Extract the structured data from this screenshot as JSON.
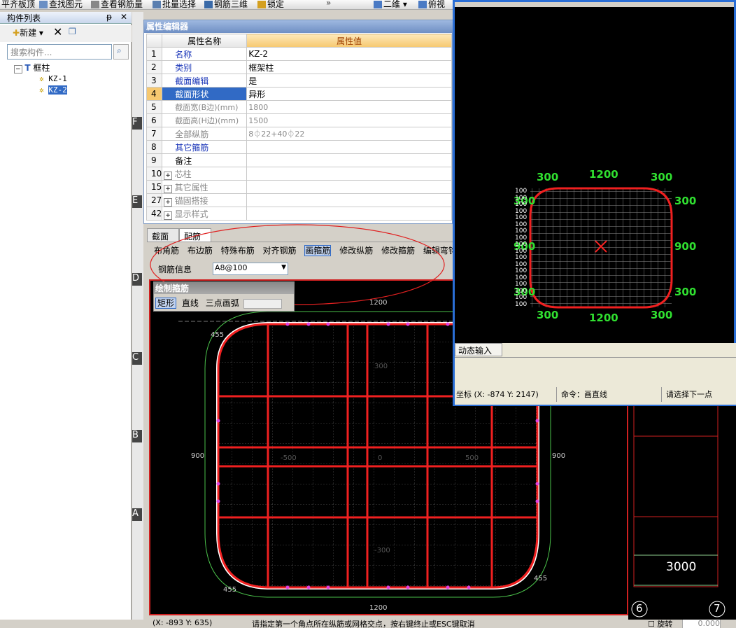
{
  "toolbar": {
    "items": [
      "平齐板顶",
      "查找图元",
      "查看钢筋量",
      "批量选择",
      "钢筋三维",
      "锁定",
      "二维",
      "俯视"
    ]
  },
  "left_panel": {
    "title": "构件列表",
    "new_label": "新建",
    "search_placeholder": "搜索构件...",
    "tree_root": "框柱",
    "tree_children": [
      "KZ-1",
      "KZ-2"
    ]
  },
  "property_editor": {
    "title": "属性编辑器",
    "col_name": "属性名称",
    "col_value": "属性值",
    "rows": [
      {
        "num": "1",
        "name": "名称",
        "value": "KZ-2"
      },
      {
        "num": "2",
        "name": "类别",
        "value": "框架柱"
      },
      {
        "num": "3",
        "name": "截面编辑",
        "value": "是"
      },
      {
        "num": "4",
        "name": "截面形状",
        "value": "异形"
      },
      {
        "num": "5",
        "name": "截面宽(B边)(mm)",
        "value": "1800"
      },
      {
        "num": "6",
        "name": "截面高(H边)(mm)",
        "value": "1500"
      },
      {
        "num": "7",
        "name": "全部纵筋",
        "value": "8⏀22+40⏀22"
      },
      {
        "num": "8",
        "name": "其它箍筋",
        "value": ""
      },
      {
        "num": "9",
        "name": "备注",
        "value": ""
      },
      {
        "num": "10",
        "name": "芯柱",
        "value": ""
      },
      {
        "num": "15",
        "name": "其它属性",
        "value": ""
      },
      {
        "num": "27",
        "name": "锚固搭接",
        "value": ""
      },
      {
        "num": "42",
        "name": "显示样式",
        "value": ""
      }
    ]
  },
  "tabs": [
    "截面",
    "配筋"
  ],
  "rebar_toolbar": [
    "布角筋",
    "布边筋",
    "特殊布筋",
    "对齐钢筋",
    "画箍筋",
    "修改纵筋",
    "修改箍筋",
    "编辑弯钩"
  ],
  "rebar_info_label": "钢筋信息",
  "rebar_info_value": "A8@100",
  "draw_stirrup": {
    "title": "绘制箍筋",
    "items": [
      "矩形",
      "直线",
      "三点画弧"
    ]
  },
  "canvas_dims": {
    "top": "1200",
    "bottom": "1200",
    "left": "900",
    "right": "900",
    "corner_tl": "455",
    "corner_bl": "455",
    "corner_br": "455",
    "axis_neg": "-500",
    "axis_zero": "0",
    "axis_pos": "500",
    "axis_y_pos": "300",
    "axis_y_neg": "-300"
  },
  "right_window": {
    "dims_top": [
      "300",
      "1200",
      "300"
    ],
    "dims_bottom": [
      "300",
      "1200",
      "300"
    ],
    "dims_right": [
      "300",
      "900",
      "300"
    ],
    "dims_left": [
      "300",
      "900",
      "300"
    ],
    "grid_labels": [
      "100",
      "100",
      "100",
      "100",
      "100",
      "100",
      "100",
      "100",
      "100",
      "100",
      "100",
      "100",
      "100",
      "100",
      "100",
      "100",
      "100",
      "100"
    ],
    "dynamic_input": "动态输入",
    "coord": "坐标 (X: -874 Y: 2147)",
    "command": "命令：画直线",
    "prompt": "请选择下一点"
  },
  "background": {
    "axis_labels": [
      "F",
      "E",
      "D",
      "C",
      "B",
      "A"
    ],
    "grid_numbers": [
      "6",
      "7"
    ],
    "dim": "3000"
  },
  "status_bar": {
    "coord": "(X: -893 Y: 635)",
    "message": "请指定第一个角点所在纵筋或网格交点，按右键终止或ESC键取消",
    "rotate_label": "旋转",
    "rotate_value": "0.000"
  }
}
